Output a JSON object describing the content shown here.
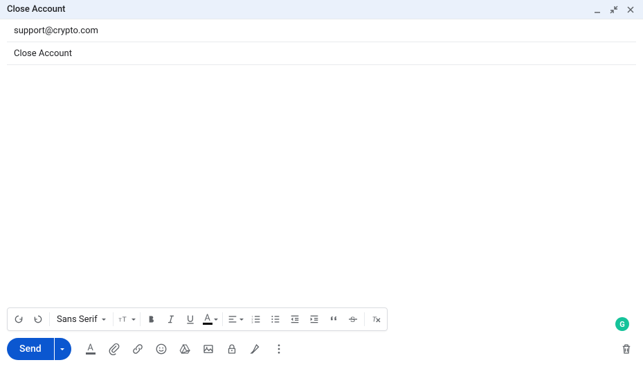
{
  "titlebar": {
    "title": "Close Account"
  },
  "fields": {
    "to": "support@crypto.com",
    "subject": "Close Account"
  },
  "format_toolbar": {
    "font": "Sans Serif"
  },
  "bottom": {
    "send_label": "Send"
  },
  "grammarly": {
    "label": "G"
  }
}
